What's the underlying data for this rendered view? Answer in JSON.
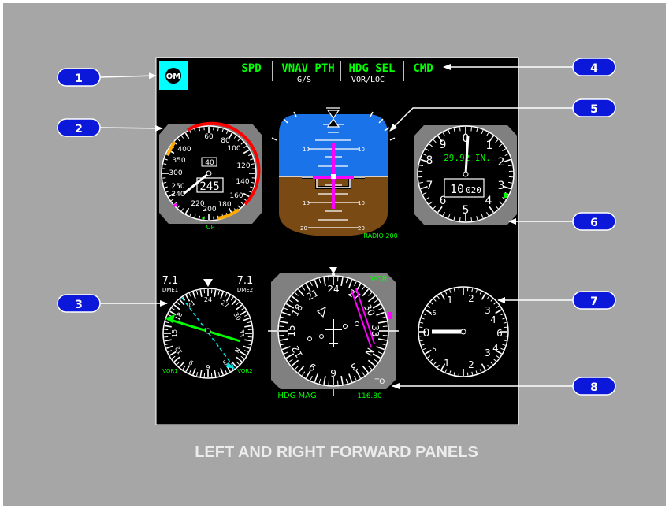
{
  "colors": {
    "page_bg": "#ffffff",
    "panel_bg": "#a6a6a6",
    "screen_bg": "#000000",
    "callout_fill": "#0b17d9",
    "annun_green": "#00ff00",
    "annun_white": "#ffffff",
    "om_cyan": "#00ffff",
    "sky": "#1a73e8",
    "ground": "#7a4a14",
    "magenta": "#ff00ff",
    "cyan_needle": "#00e5e5",
    "caption": "#ececec"
  },
  "caption": "LEFT AND RIGHT FORWARD PANELS",
  "callouts": [
    "1",
    "2",
    "3",
    "4",
    "5",
    "6",
    "7",
    "8"
  ],
  "fma": {
    "spd": "SPD",
    "vnav": "VNAV PTH",
    "gs": "G/S",
    "hdg": "HDG SEL",
    "vorloc": "VOR/LOC",
    "cmd": "CMD"
  },
  "marker": "OM",
  "airspeed": {
    "labels": [
      "60",
      "80",
      "100",
      "120",
      "140",
      "160",
      "180",
      "200",
      "220",
      "240",
      "250",
      "300",
      "350",
      "400"
    ],
    "bug_value": "40",
    "readout": "245",
    "flap_label": "UP"
  },
  "adi": {
    "pitch_labels": [
      "10",
      "10",
      "10",
      "10",
      "20",
      "20"
    ],
    "radio": "RADIO 200"
  },
  "altimeter": {
    "dial": [
      "0",
      "1",
      "2",
      "3",
      "4",
      "5",
      "6",
      "7",
      "8",
      "9"
    ],
    "baro": "29.92 IN.",
    "counter_big": "10",
    "counter_small": "020"
  },
  "rmi": {
    "dme1_value": "7.1",
    "dme1_label": "DME1",
    "dme2_value": "7.1",
    "dme2_label": "DME2",
    "compass": [
      "12",
      "15",
      "18",
      "21",
      "24",
      "27",
      "30",
      "33",
      "N",
      "3",
      "6",
      "9"
    ],
    "vor1": "VOR1",
    "vor2": "VOR2"
  },
  "hsi": {
    "compass": [
      "12",
      "15",
      "18",
      "21",
      "24",
      "27",
      "30",
      "33",
      "N",
      "3",
      "6",
      "9"
    ],
    "source": "VOR",
    "hdg_mode": "HDG MAG",
    "to_from": "TO",
    "freq": "116.80"
  },
  "clock": {
    "dial": [
      "1",
      "2",
      "3",
      "4",
      "5",
      "6",
      "1",
      "2",
      "3",
      "4",
      "5",
      "6"
    ],
    "minor": [
      ".5",
      ".5",
      ".5",
      ".5"
    ],
    "value": "0"
  }
}
